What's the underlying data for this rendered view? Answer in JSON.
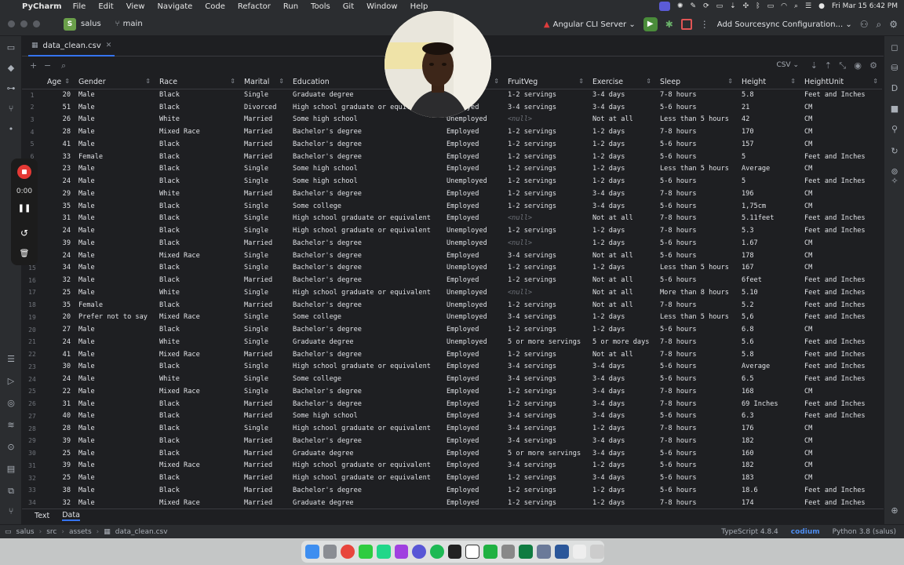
{
  "menubar": {
    "app_name": "PyCharm",
    "items": [
      "File",
      "Edit",
      "View",
      "Navigate",
      "Code",
      "Refactor",
      "Run",
      "Tools",
      "Git",
      "Window",
      "Help"
    ],
    "clock": "Fri Mar 15  6:42 PM"
  },
  "toolbar": {
    "project_badge": "S",
    "project_name": "salus",
    "branch": "main",
    "run_config": "Angular CLI Server",
    "sourcesync": "Add Sourcesync Configuration..."
  },
  "editor": {
    "tab_name": "data_clean.csv",
    "format_select": "CSV"
  },
  "recorder": {
    "time": "0:00"
  },
  "grid": {
    "columns": [
      "Age",
      "Gender",
      "Race",
      "Marital",
      "Education",
      "",
      "FruitVeg",
      "Exercise",
      "Sleep",
      "Height",
      "HeightUnit"
    ],
    "rows": [
      [
        "1",
        "20",
        "Male",
        "Black",
        "Single",
        "Graduate degree",
        "Employed",
        "1-2 servings",
        "3-4 days",
        "7-8 hours",
        "5.8",
        "Feet and Inches"
      ],
      [
        "2",
        "51",
        "Male",
        "Black",
        "Divorced",
        "High school graduate or equivalent",
        "Employed",
        "3-4 servings",
        "3-4 days",
        "5-6 hours",
        "21",
        "CM"
      ],
      [
        "3",
        "26",
        "Male",
        "White",
        "Married",
        "Some high school",
        "Unemployed",
        "<null>",
        "Not at all",
        "Less than 5 hours",
        "42",
        "CM"
      ],
      [
        "4",
        "28",
        "Male",
        "Mixed Race",
        "Married",
        "Bachelor's degree",
        "Employed",
        "1-2 servings",
        "1-2 days",
        "7-8 hours",
        "170",
        "CM"
      ],
      [
        "5",
        "41",
        "Male",
        "Black",
        "Married",
        "Bachelor's degree",
        "Employed",
        "1-2 servings",
        "1-2 days",
        "5-6 hours",
        "157",
        "CM"
      ],
      [
        "6",
        "33",
        "Female",
        "Black",
        "Married",
        "Bachelor's degree",
        "Employed",
        "1-2 servings",
        "1-2 days",
        "5-6 hours",
        "5",
        "Feet and Inches"
      ],
      [
        "7",
        "23",
        "Male",
        "Black",
        "Single",
        "Some high school",
        "Employed",
        "1-2 servings",
        "1-2 days",
        "Less than 5 hours",
        "Average",
        "CM"
      ],
      [
        "8",
        "24",
        "Male",
        "Black",
        "Single",
        "Some high school",
        "Unemployed",
        "1-2 servings",
        "1-2 days",
        "5-6 hours",
        "5",
        "Feet and Inches"
      ],
      [
        "9",
        "29",
        "Male",
        "White",
        "Married",
        "Bachelor's degree",
        "Employed",
        "1-2 servings",
        "3-4 days",
        "7-8 hours",
        "196",
        "CM"
      ],
      [
        "10",
        "35",
        "Male",
        "Black",
        "Single",
        "Some college",
        "Employed",
        "1-2 servings",
        "3-4 days",
        "5-6 hours",
        "1,75cm",
        "CM"
      ],
      [
        "11",
        "31",
        "Male",
        "Black",
        "Single",
        "High school graduate or equivalent",
        "Employed",
        "<null>",
        "Not at all",
        "7-8 hours",
        "5.11feet",
        "Feet and Inches"
      ],
      [
        "12",
        "24",
        "Male",
        "Black",
        "Single",
        "High school graduate or equivalent",
        "Unemployed",
        "1-2 servings",
        "1-2 days",
        "7-8 hours",
        "5.3",
        "Feet and Inches"
      ],
      [
        "13",
        "39",
        "Male",
        "Black",
        "Married",
        "Bachelor's degree",
        "Unemployed",
        "<null>",
        "1-2 days",
        "5-6 hours",
        "1.67",
        "CM"
      ],
      [
        "14",
        "24",
        "Male",
        "Mixed Race",
        "Single",
        "Bachelor's degree",
        "Employed",
        "3-4 servings",
        "Not at all",
        "5-6 hours",
        "178",
        "CM"
      ],
      [
        "15",
        "34",
        "Male",
        "Black",
        "Single",
        "Bachelor's degree",
        "Unemployed",
        "1-2 servings",
        "1-2 days",
        "Less than 5 hours",
        "167",
        "CM"
      ],
      [
        "16",
        "32",
        "Male",
        "Black",
        "Married",
        "Bachelor's degree",
        "Employed",
        "1-2 servings",
        "Not at all",
        "5-6 hours",
        "6feet",
        "Feet and Inches"
      ],
      [
        "17",
        "25",
        "Male",
        "White",
        "Single",
        "High school graduate or equivalent",
        "Unemployed",
        "<null>",
        "Not at all",
        "More than 8 hours",
        "5.10",
        "Feet and Inches"
      ],
      [
        "18",
        "35",
        "Female",
        "Black",
        "Married",
        "Bachelor's degree",
        "Unemployed",
        "1-2 servings",
        "Not at all",
        "7-8 hours",
        "5.2",
        "Feet and Inches"
      ],
      [
        "19",
        "20",
        "Prefer not to say",
        "Mixed Race",
        "Single",
        "Some college",
        "Unemployed",
        "3-4 servings",
        "1-2 days",
        "Less than 5 hours",
        "5,6",
        "Feet and Inches"
      ],
      [
        "20",
        "27",
        "Male",
        "Black",
        "Single",
        "Bachelor's degree",
        "Employed",
        "1-2 servings",
        "1-2 days",
        "5-6 hours",
        "6.8",
        "CM"
      ],
      [
        "21",
        "24",
        "Male",
        "White",
        "Single",
        "Graduate degree",
        "Unemployed",
        "5 or more servings",
        "5 or more days",
        "7-8 hours",
        "5.6",
        "Feet and Inches"
      ],
      [
        "22",
        "41",
        "Male",
        "Mixed Race",
        "Married",
        "Bachelor's degree",
        "Employed",
        "1-2 servings",
        "Not at all",
        "7-8 hours",
        "5.8",
        "Feet and Inches"
      ],
      [
        "23",
        "30",
        "Male",
        "Black",
        "Single",
        "High school graduate or equivalent",
        "Employed",
        "3-4 servings",
        "3-4 days",
        "5-6 hours",
        "Average",
        "Feet and Inches"
      ],
      [
        "24",
        "24",
        "Male",
        "White",
        "Single",
        "Some college",
        "Employed",
        "3-4 servings",
        "3-4 days",
        "5-6 hours",
        "6.5",
        "Feet and Inches"
      ],
      [
        "25",
        "22",
        "Male",
        "Mixed Race",
        "Single",
        "Bachelor's degree",
        "Employed",
        "1-2 servings",
        "3-4 days",
        "7-8 hours",
        "168",
        "CM"
      ],
      [
        "26",
        "31",
        "Male",
        "Black",
        "Married",
        "Bachelor's degree",
        "Employed",
        "1-2 servings",
        "3-4 days",
        "7-8 hours",
        "69 Inches",
        "Feet and Inches"
      ],
      [
        "27",
        "40",
        "Male",
        "Black",
        "Married",
        "Some high school",
        "Employed",
        "3-4 servings",
        "3-4 days",
        "5-6 hours",
        "6.3",
        "Feet and Inches"
      ],
      [
        "28",
        "28",
        "Male",
        "Black",
        "Single",
        "High school graduate or equivalent",
        "Employed",
        "3-4 servings",
        "1-2 days",
        "7-8 hours",
        "176",
        "CM"
      ],
      [
        "29",
        "39",
        "Male",
        "Black",
        "Married",
        "Bachelor's degree",
        "Employed",
        "3-4 servings",
        "3-4 days",
        "7-8 hours",
        "182",
        "CM"
      ],
      [
        "30",
        "25",
        "Male",
        "Black",
        "Married",
        "Graduate degree",
        "Employed",
        "5 or more servings",
        "3-4 days",
        "5-6 hours",
        "160",
        "CM"
      ],
      [
        "31",
        "39",
        "Male",
        "Mixed Race",
        "Married",
        "High school graduate or equivalent",
        "Employed",
        "3-4 servings",
        "1-2 days",
        "5-6 hours",
        "182",
        "CM"
      ],
      [
        "32",
        "25",
        "Male",
        "Black",
        "Married",
        "High school graduate or equivalent",
        "Employed",
        "1-2 servings",
        "3-4 days",
        "5-6 hours",
        "183",
        "CM"
      ],
      [
        "33",
        "38",
        "Male",
        "Black",
        "Married",
        "Bachelor's degree",
        "Employed",
        "1-2 servings",
        "1-2 days",
        "5-6 hours",
        "18.6",
        "Feet and Inches"
      ],
      [
        "34",
        "32",
        "Male",
        "Mixed Race",
        "Married",
        "Graduate degree",
        "Employed",
        "1-2 servings",
        "1-2 days",
        "7-8 hours",
        "174",
        "Feet and Inches"
      ]
    ]
  },
  "bottom_tabs": [
    "Text",
    "Data"
  ],
  "statusbar": {
    "breadcrumbs": [
      "salus",
      "src",
      "assets",
      "data_clean.csv"
    ],
    "typescript": "TypeScript 4.8.4",
    "codium": "codium",
    "python": "Python 3.8 (salus)"
  },
  "colors": {
    "accent": "#3574f0",
    "record": "#e53935",
    "run_green": "#4a8c3a",
    "editor_bg": "#1e1f22",
    "panel_bg": "#2b2d30"
  }
}
